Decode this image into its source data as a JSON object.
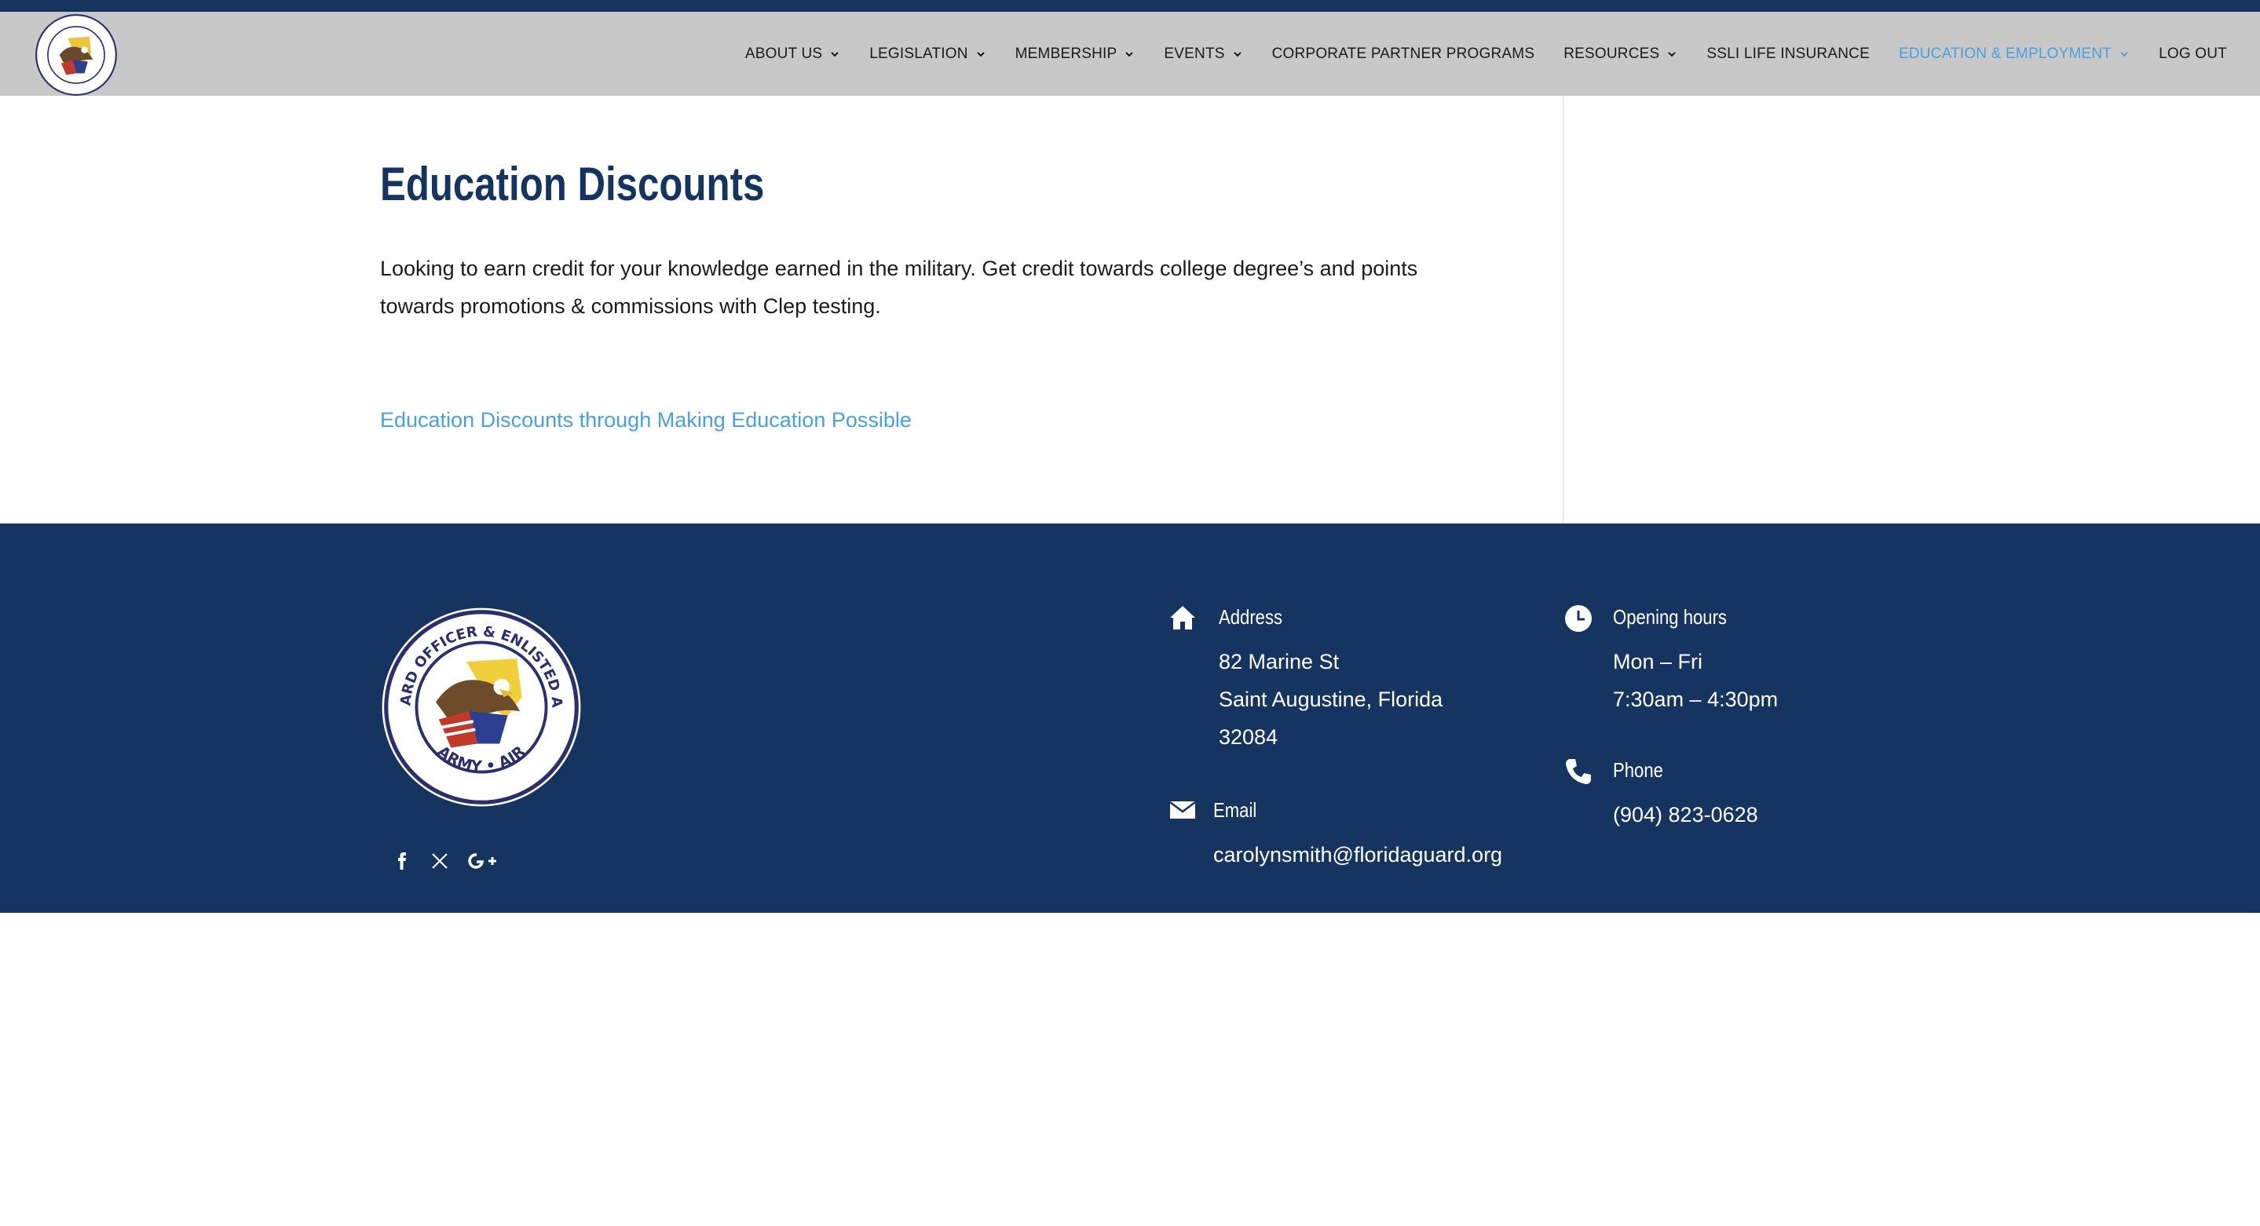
{
  "header": {
    "logo_alt": "National Guard Officer & Enlisted Associations Army Air logo",
    "nav": [
      {
        "label": "ABOUT US",
        "has_dropdown": true
      },
      {
        "label": "LEGISLATION",
        "has_dropdown": true
      },
      {
        "label": "MEMBERSHIP",
        "has_dropdown": true
      },
      {
        "label": "EVENTS",
        "has_dropdown": true
      },
      {
        "label": "CORPORATE PARTNER PROGRAMS",
        "has_dropdown": false
      },
      {
        "label": "RESOURCES",
        "has_dropdown": true
      },
      {
        "label": "SSLI LIFE INSURANCE",
        "has_dropdown": false
      },
      {
        "label": "EDUCATION & EMPLOYMENT",
        "has_dropdown": true,
        "active": true
      },
      {
        "label": "LOG OUT",
        "has_dropdown": false
      }
    ]
  },
  "main": {
    "title": "Education Discounts",
    "intro_line1": "Looking to earn credit for your knowledge earned in the military. Get credit towards college degree’s and points",
    "intro_line2": "towards promotions & commissions with Clep testing.",
    "link": "Education Discounts through Making Education Possible"
  },
  "footer": {
    "logo_alt": "National Guard Officer & Enlisted Associations Army Air seal",
    "logo_text_top": "NATIONAL GUARD OFFICER & ENLISTED ASSOCIATIONS",
    "logo_text_bottom": "ARMY • AIR",
    "social": [
      "facebook-icon",
      "x-icon",
      "google-plus-icon"
    ],
    "address": {
      "title": "Address",
      "line1": "82 Marine St",
      "line2": "Saint Augustine, Florida",
      "line3": "32084"
    },
    "email": {
      "title": "Email",
      "value": "carolynsmith@floridaguard.org"
    },
    "hours": {
      "title": "Opening hours",
      "line1": "Mon – Fri",
      "line2": "7:30am – 4:30pm"
    },
    "phone": {
      "title": "Phone",
      "value": "(904) 823-0628"
    }
  },
  "colors": {
    "navy": "#153460",
    "accent_blue": "#4a9fe0",
    "header_gray": "#c8c8c8"
  }
}
